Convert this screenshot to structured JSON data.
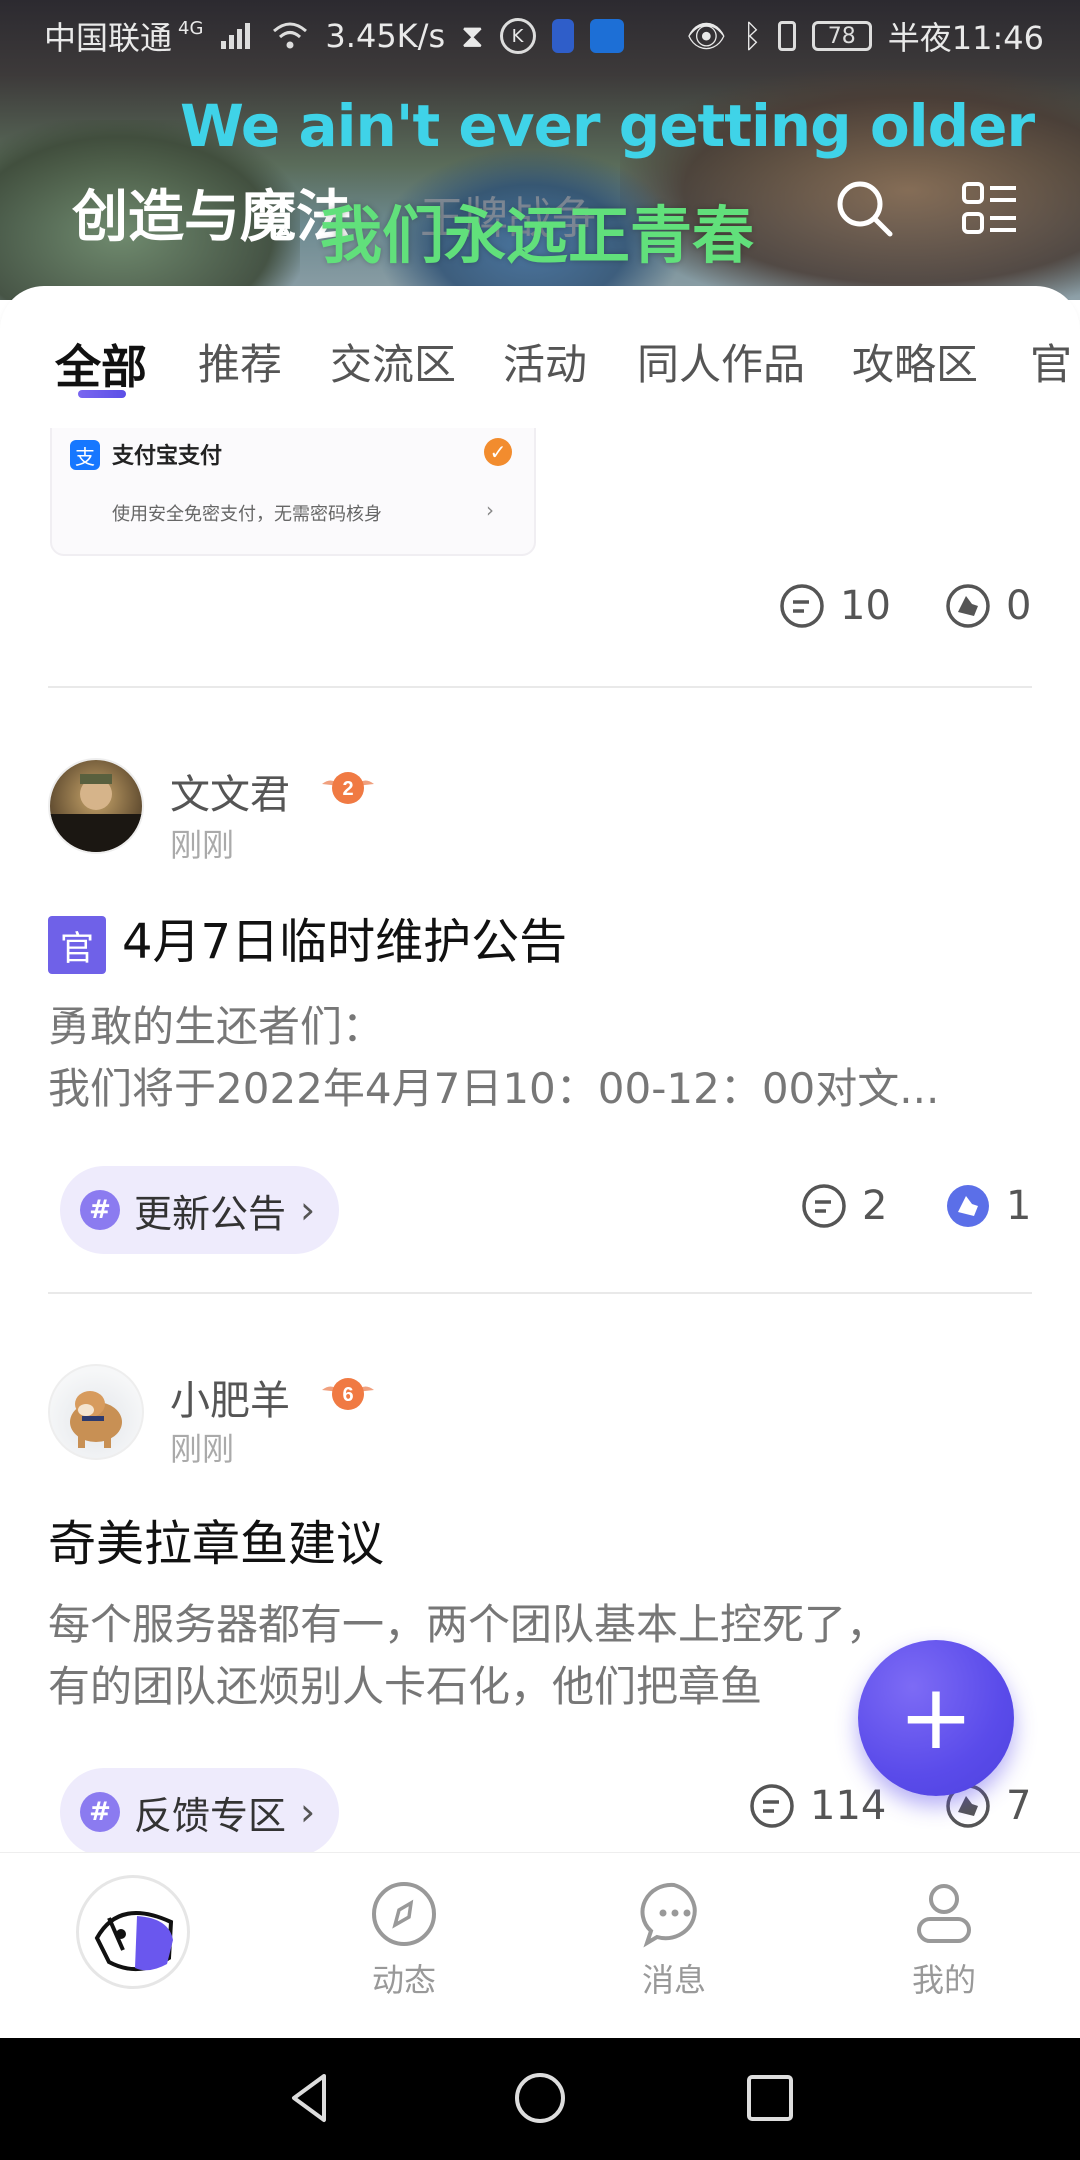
{
  "status_bar": {
    "carrier": "中国联通",
    "network": "4G",
    "speed": "3.45K/s",
    "battery": "78",
    "time": "半夜11:46"
  },
  "header": {
    "lyric_en": "We ain't ever getting older",
    "lyric_zh": "我们永远正青春",
    "app_title": "创造与魔法",
    "faded_subtitle": "王牌战争",
    "search_icon": "search-icon",
    "menu_icon": "list-menu-icon"
  },
  "tabs": [
    {
      "label": "全部",
      "active": true
    },
    {
      "label": "推荐"
    },
    {
      "label": "交流区"
    },
    {
      "label": "活动"
    },
    {
      "label": "同人作品"
    },
    {
      "label": "攻略区"
    },
    {
      "label": "官"
    }
  ],
  "partial_post": {
    "pay_title": "支付宝支付",
    "pay_desc": "使用安全免密支付，无需密码核身",
    "comments": "10",
    "likes": "0"
  },
  "posts": [
    {
      "username": "文文君",
      "level": "2",
      "time": "刚刚",
      "official_badge": "官",
      "title": "4月7日临时维护公告",
      "body_lines": [
        "勇敢的生还者们：",
        " 我们将于2022年4月7日10：00-12：00对文..."
      ],
      "tag": "更新公告",
      "comments": "2",
      "likes": "1"
    },
    {
      "username": "小肥羊",
      "level": "6",
      "time": "刚刚",
      "title": "奇美拉章鱼建议",
      "body_lines": [
        "每个服务器都有一，两个团队基本上控死了，",
        "有的团队还烦别人卡石化，他们把章鱼"
      ],
      "tag": "反馈专区",
      "comments": "114",
      "likes": "7"
    }
  ],
  "fab": {
    "label": "+"
  },
  "bottom_nav": {
    "items": [
      {
        "label": "动态",
        "icon": "compass-icon"
      },
      {
        "label": "消息",
        "icon": "chat-bubble-icon"
      },
      {
        "label": "我的",
        "icon": "profile-icon"
      }
    ]
  },
  "colors": {
    "accent": "#5b4ee6",
    "tag_bg": "#eeebfc",
    "lyric_en": "#3fd3e8",
    "lyric_zh": "#61e07b"
  }
}
